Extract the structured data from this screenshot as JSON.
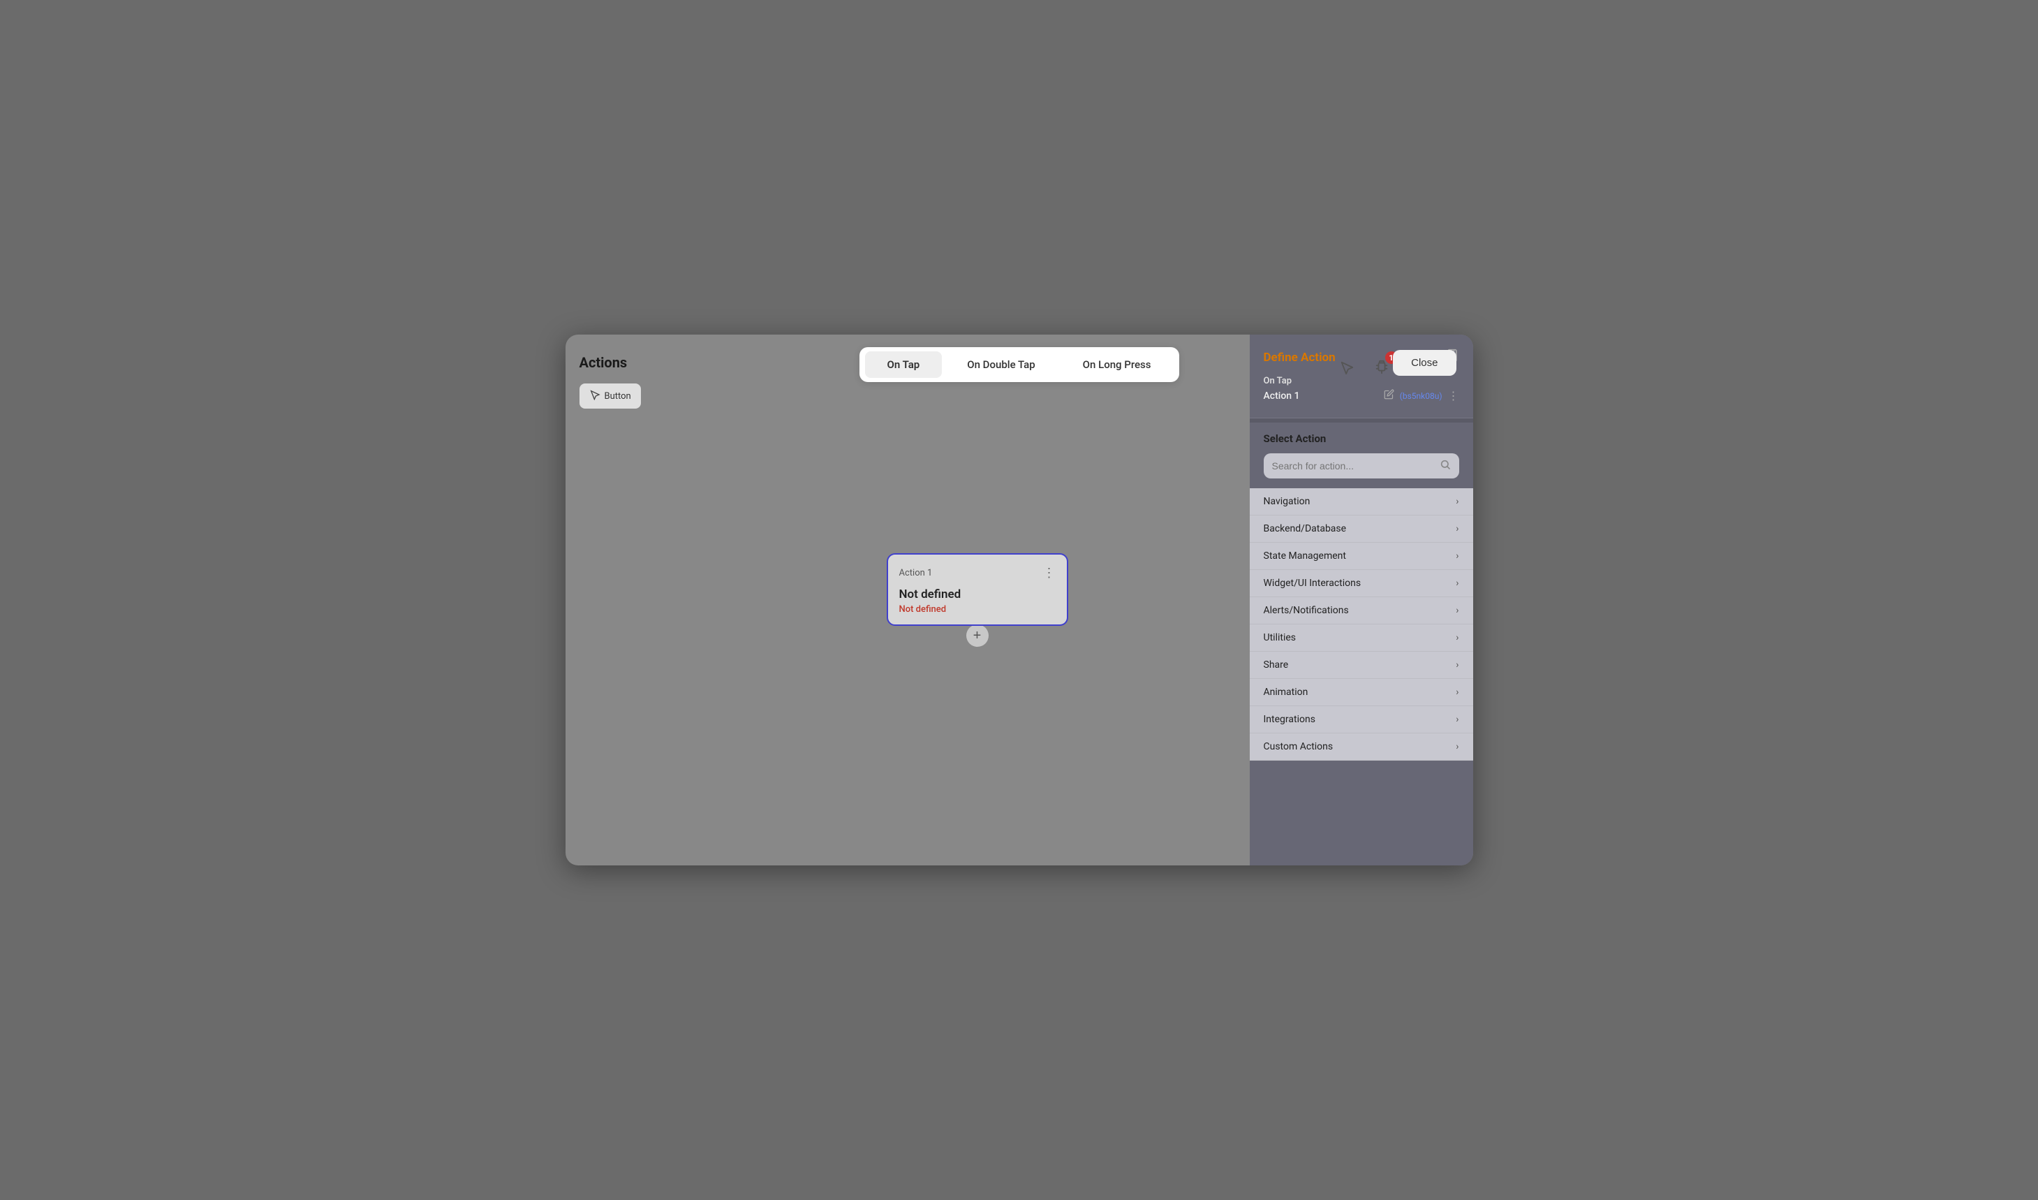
{
  "title": "Actions",
  "close_button": "Close",
  "tabs": [
    {
      "id": "on-tap",
      "label": "On Tap",
      "active": true
    },
    {
      "id": "on-double-tap",
      "label": "On Double Tap",
      "active": false
    },
    {
      "id": "on-long-press",
      "label": "On Long Press",
      "active": false
    }
  ],
  "widget_chip": {
    "icon": "cursor-icon",
    "label": "Button"
  },
  "badge_count": "1",
  "action_card": {
    "label": "Action 1",
    "title": "Not defined",
    "subtitle": "Not defined",
    "menu_icon": "⋮"
  },
  "add_button_label": "+",
  "right_panel": {
    "title": "Define Action",
    "on_tap_label": "On Tap",
    "action_name": "Action 1",
    "action_id": "(bs5nk08u)",
    "select_action_title": "Select Action",
    "search_placeholder": "Search for action...",
    "action_list": [
      {
        "label": "Navigation"
      },
      {
        "label": "Backend/Database"
      },
      {
        "label": "State Management"
      },
      {
        "label": "Widget/UI Interactions"
      },
      {
        "label": "Alerts/Notifications"
      },
      {
        "label": "Utilities"
      },
      {
        "label": "Share"
      },
      {
        "label": "Animation"
      },
      {
        "label": "Integrations"
      },
      {
        "label": "Custom Actions"
      }
    ]
  }
}
